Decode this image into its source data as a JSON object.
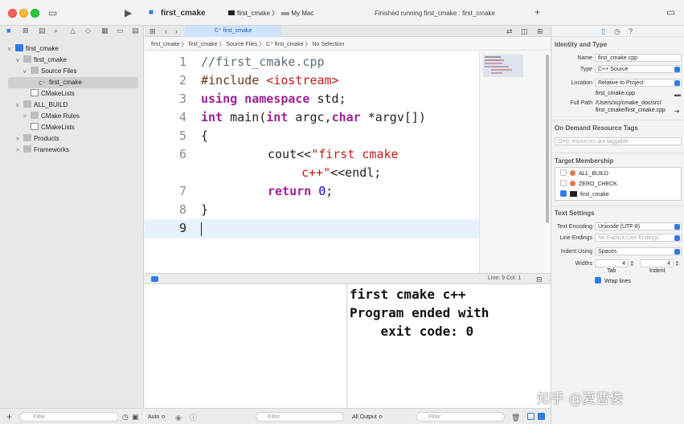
{
  "titlebar": {
    "project": "first_cmake",
    "scheme_target": "first_cmake",
    "scheme_sep": "〉",
    "scheme_device": "My Mac",
    "status": "Finished running first_cmake : first_cmake"
  },
  "navigator": {
    "items": [
      {
        "label": "first_cmake",
        "level": 0,
        "expanded": "v",
        "icon": "project"
      },
      {
        "label": "first_cmake",
        "level": 1,
        "expanded": "v",
        "icon": "folder"
      },
      {
        "label": "Source Files",
        "level": 2,
        "expanded": "v",
        "icon": "folder"
      },
      {
        "label": "first_cmake",
        "level": 3,
        "expanded": "",
        "icon": "cpp",
        "selected": true
      },
      {
        "label": "CMakeLists",
        "level": 2,
        "expanded": "",
        "icon": "doc"
      },
      {
        "label": "ALL_BUILD",
        "level": 0,
        "expanded": "v",
        "icon": "folder"
      },
      {
        "label": "CMake Rules",
        "level": 1,
        "expanded": ">",
        "icon": "folder"
      },
      {
        "label": "CMakeLists",
        "level": 1,
        "expanded": "",
        "icon": "doc"
      },
      {
        "label": "Products",
        "level": 0,
        "expanded": ">",
        "icon": "folder"
      },
      {
        "label": "Frameworks",
        "level": 0,
        "expanded": ">",
        "icon": "folder"
      }
    ],
    "filter_placeholder": "Filter"
  },
  "editor": {
    "tab_label": "C⁺ first_cmake",
    "breadcrumb": [
      "first_cmake",
      "first_cmake",
      "Source Files",
      "C⁺ first_cmake",
      "No Selection"
    ],
    "line_numbers": [
      "1",
      "2",
      "3",
      "4",
      "5",
      "6",
      "",
      "7",
      "8",
      "9"
    ],
    "lines": {
      "l1": "//first_cmake.cpp",
      "l2_pp": "#include ",
      "l2_str": "<iostream>",
      "l3_kw": "using namespace",
      "l3_rest": " std;",
      "l4_kw1": "int",
      "l4_fn": " main(",
      "l4_kw2": "int",
      "l4_mid": " argc,",
      "l4_kw3": "char",
      "l4_rest": " *argv[])",
      "l5": "{",
      "l6_a": "cout<<",
      "l6_str": "\"first cmake",
      "l6b_str": "c++\"",
      "l6b_rest": "<<endl;",
      "l7_kw": "return",
      "l7_num": "0",
      "l7_rest": ";",
      "l8": "}"
    },
    "cursor_status": "Line: 9  Col: 1"
  },
  "console": {
    "output": "first cmake c++\nProgram ended with\n    exit code: 0",
    "auto_label": "Auto ≎",
    "filter_placeholder": "Filter",
    "output_select": "All Output ≎"
  },
  "inspector": {
    "identity_title": "Identity and Type",
    "name_label": "Name",
    "name_value": "first_cmake.cpp",
    "type_label": "Type",
    "type_value": "C++ Source",
    "location_label": "Location",
    "location_value": "Relative to Project",
    "location_file": "first_cmake.cpp",
    "fullpath_label": "Full Path",
    "fullpath_value1": "/Users/xcj/cmake_doc/src/",
    "fullpath_value2": "first_cmake/first_cmake.cpp",
    "odr_title": "On Demand Resource Tags",
    "odr_placeholder": "Only resources are taggable",
    "target_title": "Target Membership",
    "targets": [
      {
        "label": "ALL_BUILD",
        "checked": false
      },
      {
        "label": "ZERO_CHECK",
        "checked": false
      },
      {
        "label": "first_cmake",
        "checked": true
      }
    ],
    "text_title": "Text Settings",
    "encoding_label": "Text Encoding",
    "encoding_value": "Unicode (UTF-8)",
    "endings_label": "Line Endings",
    "endings_value": "No Explicit Line Endings",
    "indent_label": "Indent Using",
    "indent_value": "Spaces",
    "widths_label": "Widths",
    "tab_width": "4",
    "indent_width": "4",
    "tab_caption": "Tab",
    "indent_caption": "Indent",
    "wrap_label": "Wrap lines"
  },
  "watermark": "知乎 @夏曹俊"
}
